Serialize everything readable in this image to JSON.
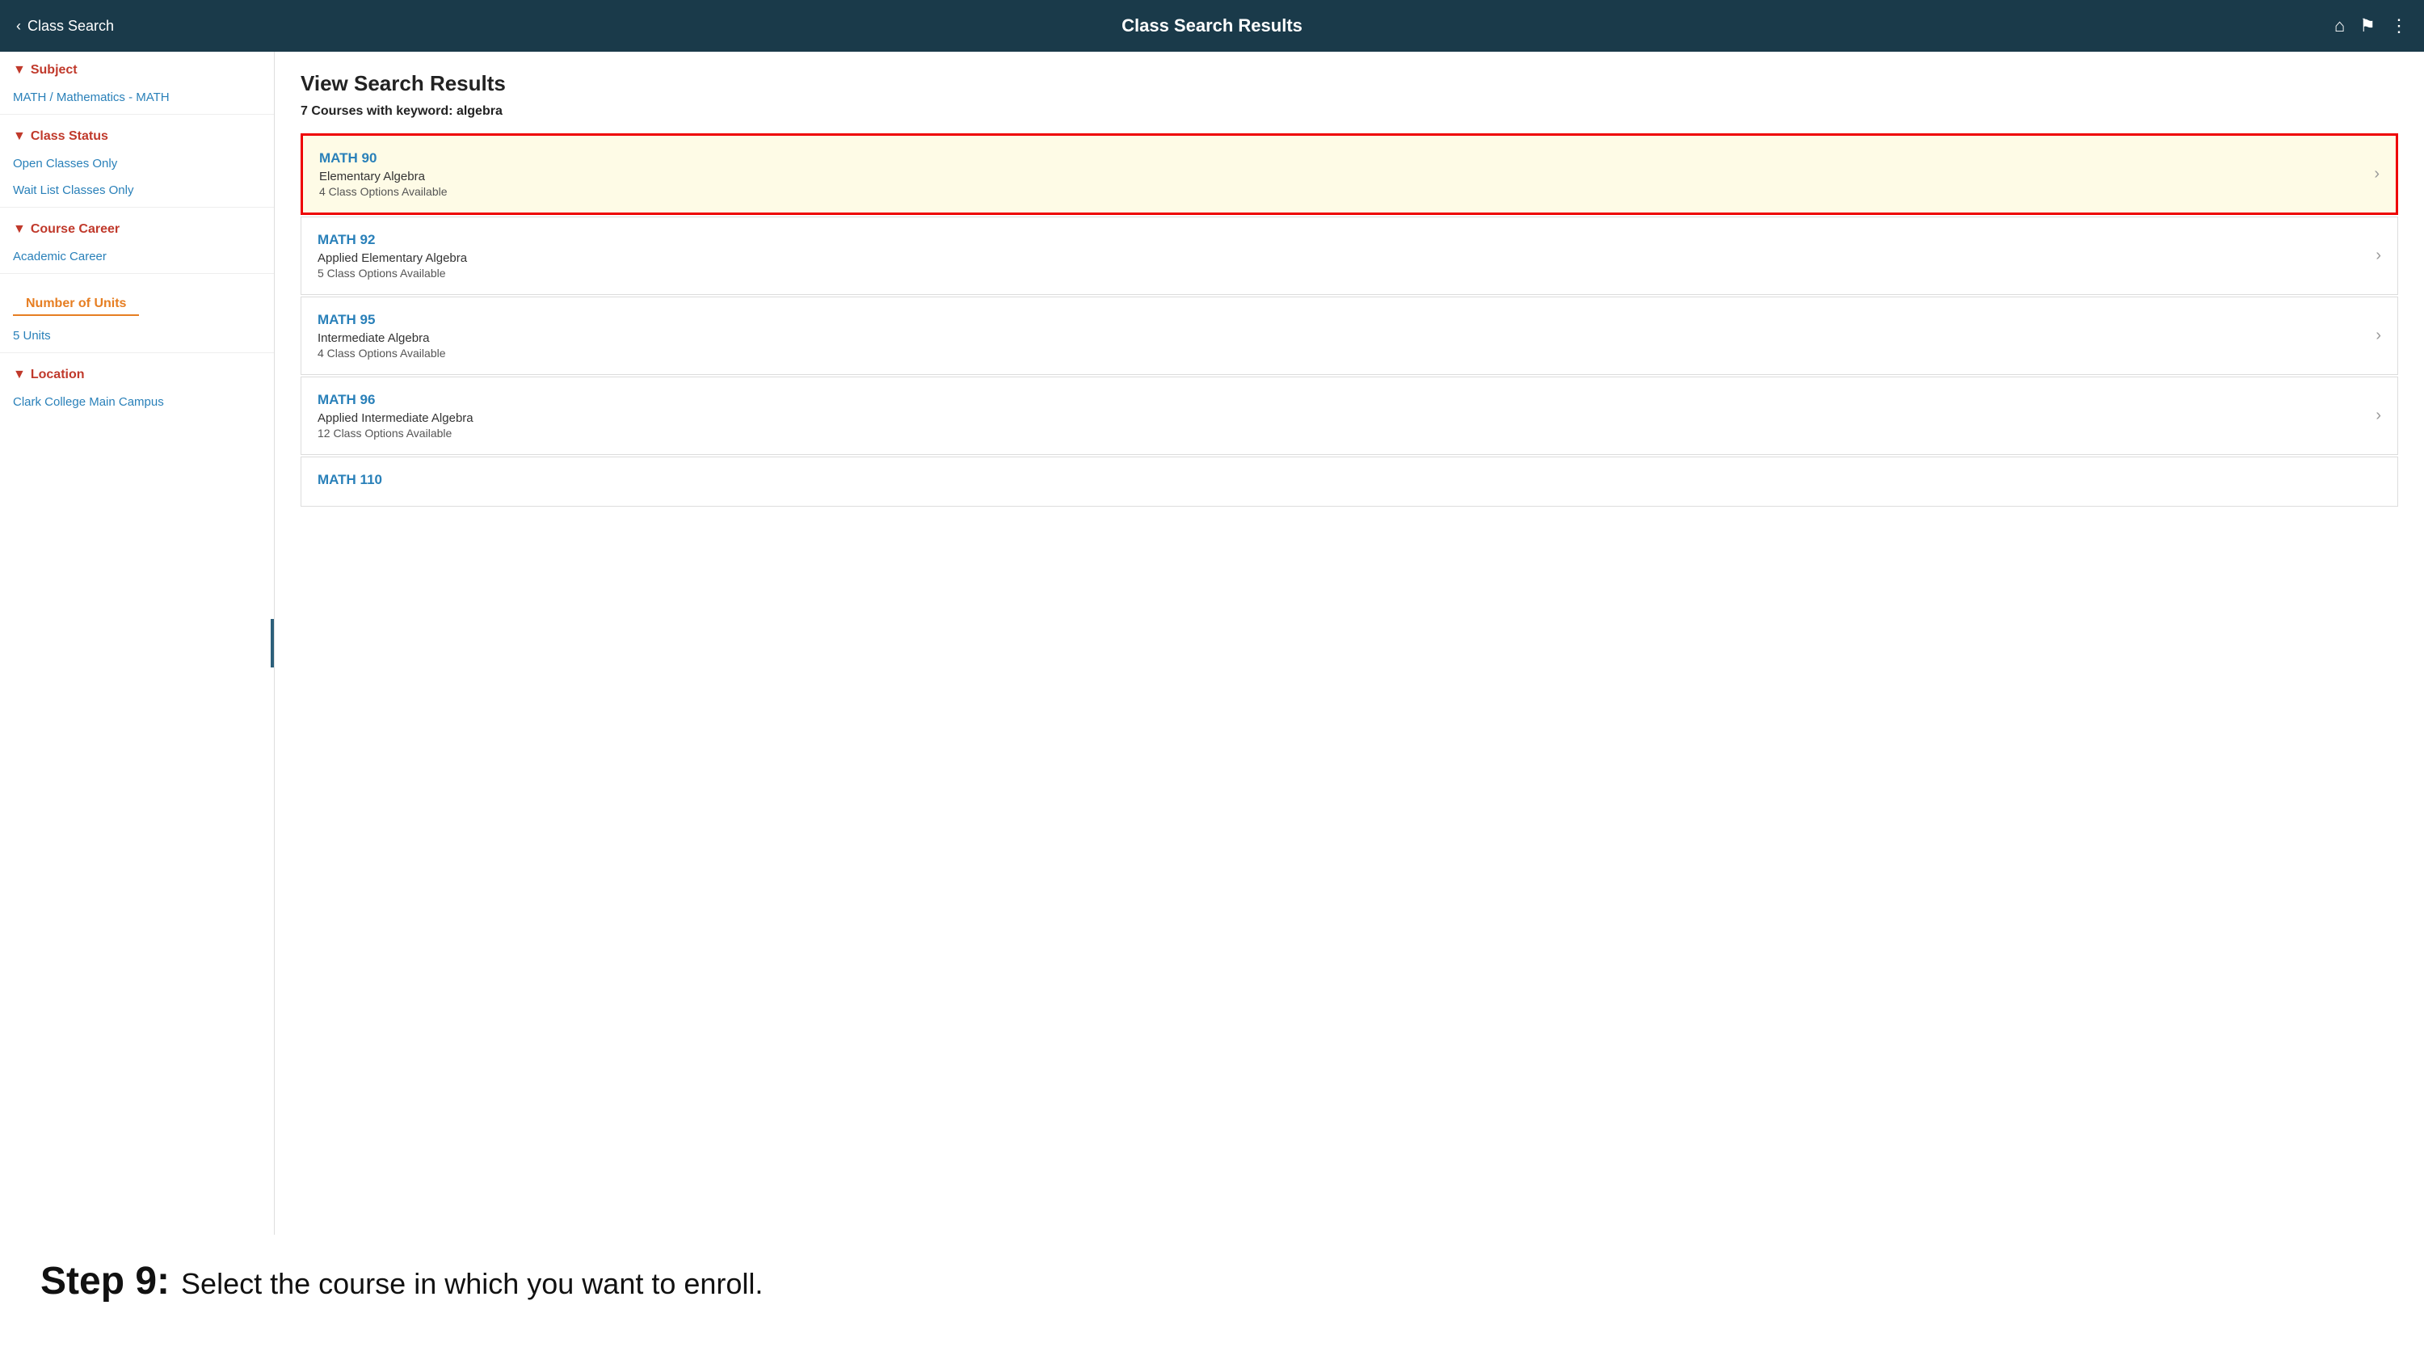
{
  "header": {
    "back_label": "Class Search",
    "title": "Class Search Results",
    "icons": [
      "home-icon",
      "flag-icon",
      "more-icon"
    ]
  },
  "sidebar": {
    "sections": [
      {
        "id": "subject",
        "label": "Subject",
        "items": [
          "MATH / Mathematics - MATH"
        ]
      },
      {
        "id": "class-status",
        "label": "Class Status",
        "items": [
          "Open Classes Only",
          "Wait List Classes Only"
        ]
      },
      {
        "id": "course-career",
        "label": "Course Career",
        "items": [
          "Academic Career"
        ]
      },
      {
        "id": "number-of-units",
        "label": "Number of Units",
        "items": [
          "5 Units"
        ]
      },
      {
        "id": "location",
        "label": "Location",
        "items": [
          "Clark College Main Campus"
        ]
      }
    ]
  },
  "content": {
    "title": "View Search Results",
    "result_count_number": "7",
    "result_count_text": "Courses with keyword: algebra",
    "courses": [
      {
        "code": "MATH 90",
        "name": "Elementary Algebra",
        "options": "4 Class Options Available",
        "highlighted": true
      },
      {
        "code": "MATH 92",
        "name": "Applied Elementary Algebra",
        "options": "5 Class Options Available",
        "highlighted": false
      },
      {
        "code": "MATH 95",
        "name": "Intermediate Algebra",
        "options": "4 Class Options Available",
        "highlighted": false
      },
      {
        "code": "MATH 96",
        "name": "Applied Intermediate Algebra",
        "options": "12 Class Options Available",
        "highlighted": false
      },
      {
        "code": "MATH 110",
        "name": "",
        "options": "",
        "highlighted": false
      }
    ]
  },
  "step": {
    "label": "Step 9:",
    "text": "Select the course in which you want to enroll."
  }
}
